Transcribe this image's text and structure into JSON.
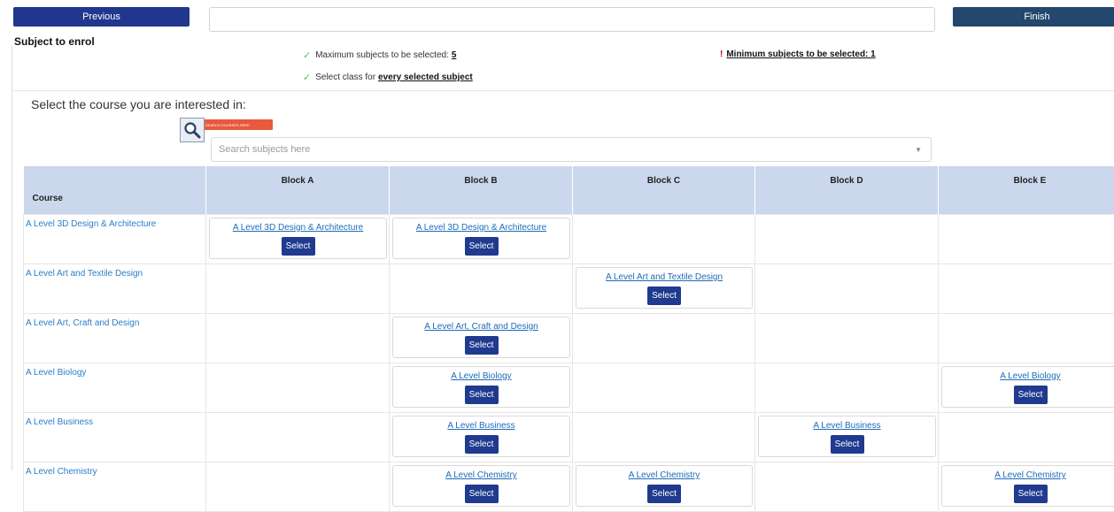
{
  "nav": {
    "previous_label": "Previous",
    "finish_label": "Finish"
  },
  "section_title": "Subject to enrol",
  "rules": {
    "max_text": "Maximum subjects to be selected:",
    "max_value": "5",
    "class_text": "Select class for",
    "class_strong": "every selected subject",
    "min_text": "Minimum subjects to be selected: 1"
  },
  "course_prompt": "Select the course you are interested in:",
  "search": {
    "banner": "SEARCH COURSES HERE",
    "placeholder": "Search subjects here"
  },
  "table": {
    "headers": [
      "Course",
      "Block A",
      "Block B",
      "Block C",
      "Block D",
      "Block E"
    ],
    "select_label": "Select",
    "rows": [
      {
        "course": "A Level 3D Design & Architecture",
        "blocks": [
          "A Level 3D Design & Architecture",
          "A Level 3D Design & Architecture",
          "",
          "",
          ""
        ]
      },
      {
        "course": "A Level Art and Textile Design",
        "blocks": [
          "",
          "",
          "A Level Art and Textile Design",
          "",
          ""
        ]
      },
      {
        "course": "A Level Art, Craft and Design",
        "blocks": [
          "",
          "A Level Art, Craft and Design",
          "",
          "",
          ""
        ]
      },
      {
        "course": "A Level Biology",
        "blocks": [
          "",
          "A Level Biology",
          "",
          "",
          "A Level Biology"
        ]
      },
      {
        "course": "A Level Business",
        "blocks": [
          "",
          "A Level Business",
          "",
          "A Level Business",
          ""
        ]
      },
      {
        "course": "A Level Chemistry",
        "blocks": [
          "",
          "A Level Chemistry",
          "A Level Chemistry",
          "",
          "A Level Chemistry"
        ]
      }
    ]
  },
  "colors": {
    "primary_button": "#21378d",
    "finish_button": "#23476d",
    "header_bg": "#cbd7ed",
    "link": "#1e6bb8",
    "check": "#5cb85c",
    "warning": "#c00000",
    "search_banner": "#e9593e"
  }
}
